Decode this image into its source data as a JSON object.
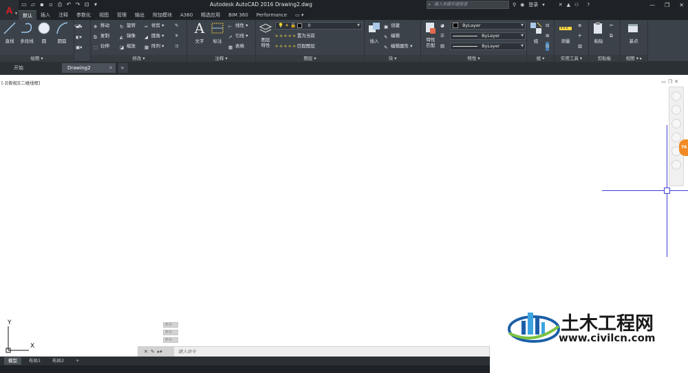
{
  "app": {
    "title": "Autodesk AutoCAD 2016    Drawing2.dwg",
    "logo_letter": "A",
    "search_placeholder": "键入关键字或短语",
    "login_label": "登录"
  },
  "ribbon_tabs": [
    "默认",
    "插入",
    "注释",
    "参数化",
    "视图",
    "管理",
    "输出",
    "附加模块",
    "A360",
    "精选应用",
    "BIM 360",
    "Performance"
  ],
  "draw_panel": {
    "title": "绘图 ▾",
    "line": "直线",
    "polyline": "多段线",
    "circle": "圆",
    "arc": "圆弧"
  },
  "modify_panel": {
    "title": "修改 ▾",
    "move": "移动",
    "rotate": "旋转",
    "trim": "修剪",
    "copy": "复制",
    "mirror": "镜像",
    "fillet": "圆角",
    "stretch": "拉伸",
    "scale": "缩放",
    "array": "阵列"
  },
  "annotation_panel": {
    "title": "注释 ▾",
    "text": "文字",
    "dimension": "标注",
    "linear": "线性",
    "leader": "引线",
    "table": "表格"
  },
  "layers_panel": {
    "title": "图层 ▾",
    "layer_properties": "图层\n特性",
    "layer_value": "0",
    "set_current": "置为当前",
    "match_layer": "匹配图层"
  },
  "block_panel": {
    "title": "块 ▾",
    "insert": "插入",
    "create": "创建",
    "edit": "编辑",
    "edit_attributes": "编辑属性"
  },
  "properties_panel": {
    "title": "特性 ▾",
    "match": "特性\n匹配",
    "color": "ByLayer",
    "linetype": "ByLayer",
    "lineweight": "ByLayer"
  },
  "groups_panel": {
    "title": "组 ▾",
    "group": "组"
  },
  "utilities_panel": {
    "title": "实用工具 ▾",
    "measure": "测量"
  },
  "clipboard_panel": {
    "title": "剪贴板",
    "paste": "粘贴"
  },
  "view_panel": {
    "title": "视图 ▾ ▸",
    "base": "基点"
  },
  "file_tabs": {
    "start": "开始",
    "drawing": "Drawing2",
    "add": "+"
  },
  "viewport": {
    "label": "[-][俯视][二维线框]"
  },
  "ucs": {
    "x": "X",
    "y": "Y"
  },
  "command_history": [
    "命令:",
    "命令:",
    "命令:"
  ],
  "command_line": {
    "placeholder": "键入命令"
  },
  "layout_tabs": [
    "模型",
    "布局1",
    "布局2",
    "+"
  ],
  "navbar_badge": "76",
  "watermark": {
    "title": "土木工程网",
    "url": "www.civilcn.com"
  },
  "colors": {
    "ribbon_bg": "#3b4249",
    "titlebar_bg": "#1e2226",
    "crosshair": "#3c3cd8",
    "accent_orange": "#f08a24"
  }
}
